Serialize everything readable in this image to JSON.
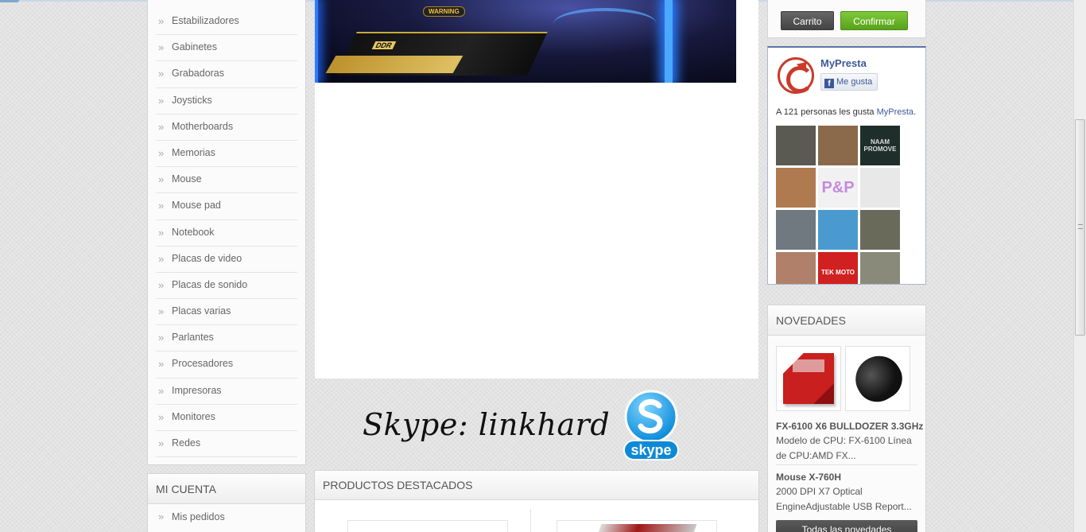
{
  "categories": {
    "items": [
      "Estabilizadores",
      "Gabinetes",
      "Grabadoras",
      "Joysticks",
      "Motherboards",
      "Memorias",
      "Mouse",
      "Mouse pad",
      "Notebook",
      "Placas de video",
      "Placas de sonido",
      "Placas varias",
      "Parlantes",
      "Procesadores",
      "Impresoras",
      "Monitores",
      "Redes"
    ]
  },
  "account": {
    "title": "MI CUENTA",
    "items": [
      "Mis pedidos"
    ]
  },
  "hero": {
    "warning_label": "WARNING",
    "badge_label": "DDR"
  },
  "skype": {
    "text": "Skype: linkhard",
    "logo_text": "skype"
  },
  "featured": {
    "title": "PRODUCTOS DESTACADOS"
  },
  "cart": {
    "cart_label": "Carrito",
    "confirm_label": "Confirmar"
  },
  "facebook": {
    "page_name": "MyPresta",
    "like_label": "Me gusta",
    "count_prefix": "A 121 personas les gusta ",
    "count_link": "MyPresta",
    "count_suffix": ".",
    "fan_labels": [
      "",
      "",
      "NAAM PROMOVE",
      "",
      "P&P",
      "",
      "",
      "",
      "",
      "",
      "TEK MOTO",
      ""
    ],
    "fan_colors": [
      "#5a5a52",
      "#8a6a4a",
      "#1e2e2a",
      "#b07a50",
      "#f1f1f1",
      "#e8e8e8",
      "#707880",
      "#4a9ad0",
      "#6a6a5a",
      "#b0806a",
      "#d02020",
      "#8a8a7a"
    ]
  },
  "news": {
    "title": "NOVEDADES",
    "products": [
      {
        "name": "FX-6100 X6 BULLDOZER 3.3GHz",
        "desc_line1": "Modelo de CPU: FX-6100 Línea",
        "desc_line2": "de CPU:AMD FX..."
      },
      {
        "name": "Mouse X-760H",
        "desc_line1": "2000 DPI X7 Optical",
        "desc_line2": "EngineAdjustable USB Report..."
      }
    ],
    "all_label": "Todas las novedades"
  }
}
